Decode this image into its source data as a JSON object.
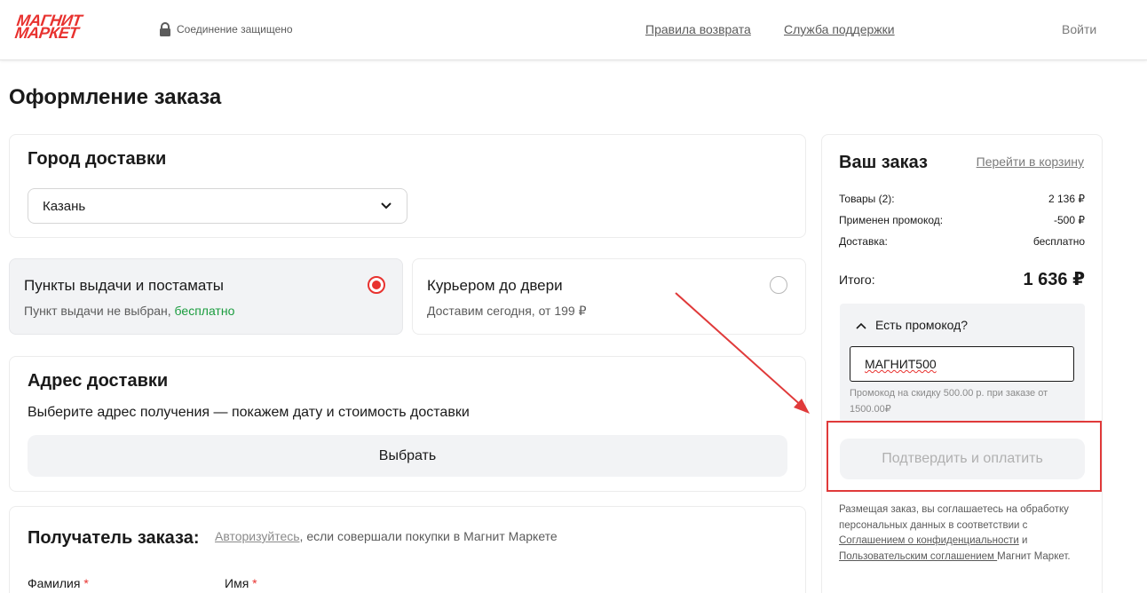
{
  "header": {
    "logo": [
      "МАГНИТ",
      "МАРКЕТ"
    ],
    "secure_text": "Соединение защищено",
    "return_rules": "Правила возврата",
    "support": "Служба поддержки",
    "login": "Войти"
  },
  "page_title": "Оформление заказа",
  "city": {
    "title": "Город доставки",
    "selected": "Казань"
  },
  "delivery_options": [
    {
      "title": "Пункты выдачи и постаматы",
      "sub_prefix": "Пункт выдачи не выбран, ",
      "sub_accent": "бесплатно",
      "selected": true
    },
    {
      "title": "Курьером до двери",
      "sub_prefix": "Доставим сегодня, от 199 ₽",
      "sub_accent": "",
      "selected": false
    }
  ],
  "address": {
    "title": "Адрес доставки",
    "subtitle": "Выберите адрес получения — покажем дату и стоимость доставки",
    "button": "Выбрать"
  },
  "recipient": {
    "title": "Получатель заказа:",
    "auth_link": "Авторизуйтесь",
    "note": ", если совершали покупки в Магнит Маркете",
    "last_name": "Фамилия",
    "first_name": "Имя",
    "required_mark": "*"
  },
  "summary": {
    "title": "Ваш заказ",
    "cart_link": "Перейти в корзину",
    "rows": [
      {
        "label": "Товары (2):",
        "value": "2 136 ₽"
      },
      {
        "label": "Применен промокод:",
        "value": "-500 ₽"
      },
      {
        "label": "Доставка:",
        "value": "бесплатно"
      }
    ],
    "total_label": "Итого:",
    "total_value": "1 636 ₽",
    "promo": {
      "toggle": "Есть промокод?",
      "value": "МАГНИТ500",
      "hint": "Промокод на скидку 500.00 р. при заказе от 1500.00₽"
    },
    "pay_button": "Подтвердить и оплатить",
    "terms": {
      "t1": "Размещая заказ, вы соглашаетесь на обработку персональных данных в соответствии с ",
      "link1": "Соглашением о конфиденциальности",
      "t2": " и ",
      "link2": "Пользовательским соглашением ",
      "t3": "Магнит Маркет."
    }
  },
  "colors": {
    "brand": "#e8322f",
    "accent_green": "#1a9c3e",
    "annotation": "#e03a3a"
  }
}
